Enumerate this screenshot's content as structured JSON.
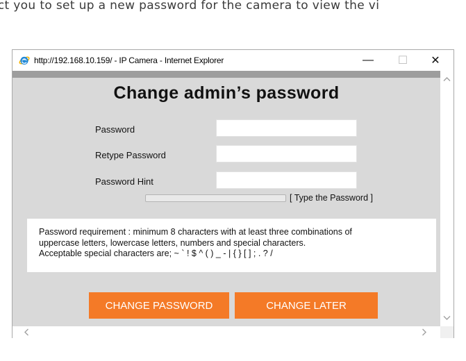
{
  "page": {
    "intro_text": "ect you to set up a new password for the camera to view the vi"
  },
  "window": {
    "title": "http://192.168.10.159/ - IP Camera - Internet Explorer",
    "minimize_glyph": "—",
    "maximize_glyph": "☐",
    "close_glyph": "✕"
  },
  "form": {
    "heading": "Change admin’s password",
    "fields": [
      {
        "label": "Password",
        "value": "",
        "placeholder": ""
      },
      {
        "label": "Retype Password",
        "value": "",
        "placeholder": ""
      },
      {
        "label": "Password Hint",
        "value": "",
        "placeholder": ""
      }
    ],
    "strength": {
      "level": 0,
      "text": "[ Type the Password ]"
    },
    "requirement_lines": [
      "Password requirement : minimum 8 characters with at least three combinations of",
      "uppercase letters, lowercase letters, numbers and special characters.",
      "Acceptable special characters are; ~ ` ! $ ^ ( ) _ - | { } [ ] ; . ? /"
    ],
    "buttons": {
      "change_label": "CHANGE PASSWORD",
      "later_label": "CHANGE LATER"
    }
  },
  "icons": {
    "browser": "internet-explorer-icon",
    "scroll_up": "chevron-up-icon",
    "scroll_down": "chevron-down-icon",
    "scroll_left": "chevron-left-icon",
    "scroll_right": "chevron-right-icon"
  },
  "colors": {
    "accent_button": "#f47a27",
    "panel_background": "#d9d9d9",
    "header_strip": "#9d9d9d",
    "ie_blue": "#1e88d8",
    "ie_gold": "#f5b400"
  }
}
